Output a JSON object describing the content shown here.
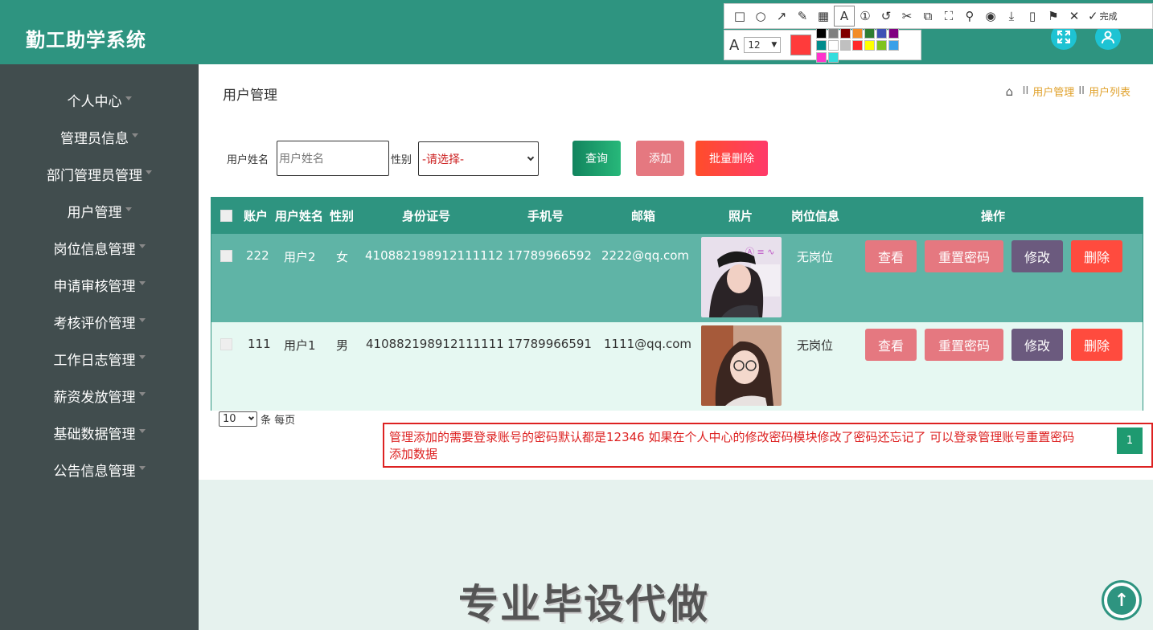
{
  "app": {
    "title": "勤工助学系统"
  },
  "snip_toolbar": {
    "tools": [
      "rect-icon",
      "ellipse-icon",
      "arrow-icon",
      "pen-icon",
      "mosaic-icon",
      "text-icon",
      "number-icon",
      "undo-icon",
      "cutout-icon",
      "ocr-icon",
      "scroll-icon",
      "pin-icon",
      "record-icon",
      "download-icon",
      "device-icon",
      "bookmark-icon",
      "close-icon"
    ],
    "done_label": "完成",
    "font_size": "12",
    "current_color": "#ff3b3b",
    "palette": [
      "#000000",
      "#808080",
      "#800000",
      "#f28c28",
      "#2e7d32",
      "#3f51b5",
      "#800080",
      "#008b8b",
      "#ffffff",
      "#c0c0c0",
      "#ff2a2a",
      "#ffff00",
      "#7fc31c",
      "#3aa0e8",
      "#ff33cc",
      "#33dddd"
    ]
  },
  "sidebar": {
    "items": [
      {
        "label": "个人中心"
      },
      {
        "label": "管理员信息"
      },
      {
        "label": "部门管理员管理"
      },
      {
        "label": "用户管理"
      },
      {
        "label": "岗位信息管理"
      },
      {
        "label": "申请审核管理"
      },
      {
        "label": "考核评价管理"
      },
      {
        "label": "工作日志管理"
      },
      {
        "label": "薪资发放管理"
      },
      {
        "label": "基础数据管理"
      },
      {
        "label": "公告信息管理"
      }
    ]
  },
  "main": {
    "title": "用户管理",
    "breadcrumb": [
      "用户管理",
      "用户列表"
    ],
    "breadcrumb_sep": "II",
    "search": {
      "name_label": "用户姓名",
      "name_placeholder": "用户姓名",
      "gender_label": "性别",
      "gender_value": "-请选择-"
    },
    "buttons": {
      "query": "查询",
      "add": "添加",
      "batch_delete": "批量删除"
    },
    "table": {
      "headers": [
        "账户",
        "用户姓名",
        "性别",
        "身份证号",
        "手机号",
        "邮箱",
        "照片",
        "岗位信息",
        "操作"
      ],
      "rows": [
        {
          "account": "222",
          "name": "用户2",
          "gender": "女",
          "id_no": "410882198912111112",
          "phone": "17789966592",
          "email": "2222@qq.com",
          "job": "无岗位"
        },
        {
          "account": "111",
          "name": "用户1",
          "gender": "男",
          "id_no": "410882198912111111",
          "phone": "17789966591",
          "email": "1111@qq.com",
          "job": "无岗位"
        }
      ],
      "actions": {
        "view": "查看",
        "reset": "重置密码",
        "edit": "修改",
        "delete": "删除"
      }
    },
    "pagination": {
      "page_size": "10",
      "unit_label": "条 每页",
      "current_page": "1"
    }
  },
  "note": {
    "line1": "管理添加的需要登录账号的密码默认都是12346 如果在个人中心的修改密码模块修改了密码还忘记了 可以登录管理账号重置密码",
    "line2": "添加数据"
  },
  "watermark": "专业毕设代做",
  "colors": {
    "header": "#2e9480",
    "sidebar": "#414d4e",
    "accent_gold": "#e0a12b"
  }
}
